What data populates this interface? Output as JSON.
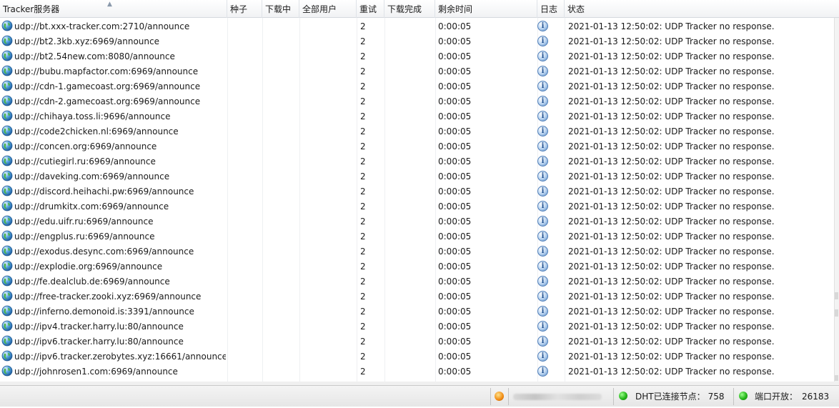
{
  "columns": {
    "tracker": "Tracker服务器",
    "seeds": "种子",
    "downloading": "下载中",
    "all_users": "全部用户",
    "retry": "重试",
    "completed": "下载完成",
    "remaining": "剩余时间",
    "log": "日志",
    "status": "状态"
  },
  "icons": {
    "row_icon": "globe-icon",
    "log_icon": "info-icon",
    "sort_icon": "sort-ascending-icon"
  },
  "colors": {
    "header_bg": "#f1f2f4",
    "status_green": "#25b61a",
    "warning_orange": "#f08a12"
  },
  "trackers": [
    {
      "url": "udp://bt.xxx-tracker.com:2710/announce",
      "retry": "2",
      "remaining": "0:00:05",
      "status": "2021-01-13 12:50:02: UDP Tracker no response."
    },
    {
      "url": "udp://bt2.3kb.xyz:6969/announce",
      "retry": "2",
      "remaining": "0:00:05",
      "status": "2021-01-13 12:50:02: UDP Tracker no response."
    },
    {
      "url": "udp://bt2.54new.com:8080/announce",
      "retry": "2",
      "remaining": "0:00:05",
      "status": "2021-01-13 12:50:02: UDP Tracker no response."
    },
    {
      "url": "udp://bubu.mapfactor.com:6969/announce",
      "retry": "2",
      "remaining": "0:00:05",
      "status": "2021-01-13 12:50:02: UDP Tracker no response."
    },
    {
      "url": "udp://cdn-1.gamecoast.org:6969/announce",
      "retry": "2",
      "remaining": "0:00:05",
      "status": "2021-01-13 12:50:02: UDP Tracker no response."
    },
    {
      "url": "udp://cdn-2.gamecoast.org:6969/announce",
      "retry": "2",
      "remaining": "0:00:05",
      "status": "2021-01-13 12:50:02: UDP Tracker no response."
    },
    {
      "url": "udp://chihaya.toss.li:9696/announce",
      "retry": "2",
      "remaining": "0:00:05",
      "status": "2021-01-13 12:50:02: UDP Tracker no response."
    },
    {
      "url": "udp://code2chicken.nl:6969/announce",
      "retry": "2",
      "remaining": "0:00:05",
      "status": "2021-01-13 12:50:02: UDP Tracker no response."
    },
    {
      "url": "udp://concen.org:6969/announce",
      "retry": "2",
      "remaining": "0:00:05",
      "status": "2021-01-13 12:50:02: UDP Tracker no response."
    },
    {
      "url": "udp://cutiegirl.ru:6969/announce",
      "retry": "2",
      "remaining": "0:00:05",
      "status": "2021-01-13 12:50:02: UDP Tracker no response."
    },
    {
      "url": "udp://daveking.com:6969/announce",
      "retry": "2",
      "remaining": "0:00:05",
      "status": "2021-01-13 12:50:02: UDP Tracker no response."
    },
    {
      "url": "udp://discord.heihachi.pw:6969/announce",
      "retry": "2",
      "remaining": "0:00:05",
      "status": "2021-01-13 12:50:02: UDP Tracker no response."
    },
    {
      "url": "udp://drumkitx.com:6969/announce",
      "retry": "2",
      "remaining": "0:00:05",
      "status": "2021-01-13 12:50:02: UDP Tracker no response."
    },
    {
      "url": "udp://edu.uifr.ru:6969/announce",
      "retry": "2",
      "remaining": "0:00:05",
      "status": "2021-01-13 12:50:02: UDP Tracker no response."
    },
    {
      "url": "udp://engplus.ru:6969/announce",
      "retry": "2",
      "remaining": "0:00:05",
      "status": "2021-01-13 12:50:02: UDP Tracker no response."
    },
    {
      "url": "udp://exodus.desync.com:6969/announce",
      "retry": "2",
      "remaining": "0:00:05",
      "status": "2021-01-13 12:50:02: UDP Tracker no response."
    },
    {
      "url": "udp://explodie.org:6969/announce",
      "retry": "2",
      "remaining": "0:00:05",
      "status": "2021-01-13 12:50:02: UDP Tracker no response."
    },
    {
      "url": "udp://fe.dealclub.de:6969/announce",
      "retry": "2",
      "remaining": "0:00:05",
      "status": "2021-01-13 12:50:02: UDP Tracker no response."
    },
    {
      "url": "udp://free-tracker.zooki.xyz:6969/announce",
      "retry": "2",
      "remaining": "0:00:05",
      "status": "2021-01-13 12:50:02: UDP Tracker no response."
    },
    {
      "url": "udp://inferno.demonoid.is:3391/announce",
      "retry": "2",
      "remaining": "0:00:05",
      "status": "2021-01-13 12:50:02: UDP Tracker no response."
    },
    {
      "url": "udp://ipv4.tracker.harry.lu:80/announce",
      "retry": "2",
      "remaining": "0:00:05",
      "status": "2021-01-13 12:50:02: UDP Tracker no response."
    },
    {
      "url": "udp://ipv6.tracker.harry.lu:80/announce",
      "retry": "2",
      "remaining": "0:00:05",
      "status": "2021-01-13 12:50:02: UDP Tracker no response."
    },
    {
      "url": "udp://ipv6.tracker.zerobytes.xyz:16661/announce",
      "retry": "2",
      "remaining": "0:00:05",
      "status": "2021-01-13 12:50:02: UDP Tracker no response."
    },
    {
      "url": "udp://johnrosen1.com:6969/announce",
      "retry": "2",
      "remaining": "0:00:05",
      "status": "2021-01-13 12:50:02: UDP Tracker no response."
    }
  ],
  "status_bar": {
    "dht_label": "DHT已连接节点：",
    "dht_nodes": "758",
    "port_label": "端口开放：",
    "port": "26183"
  }
}
